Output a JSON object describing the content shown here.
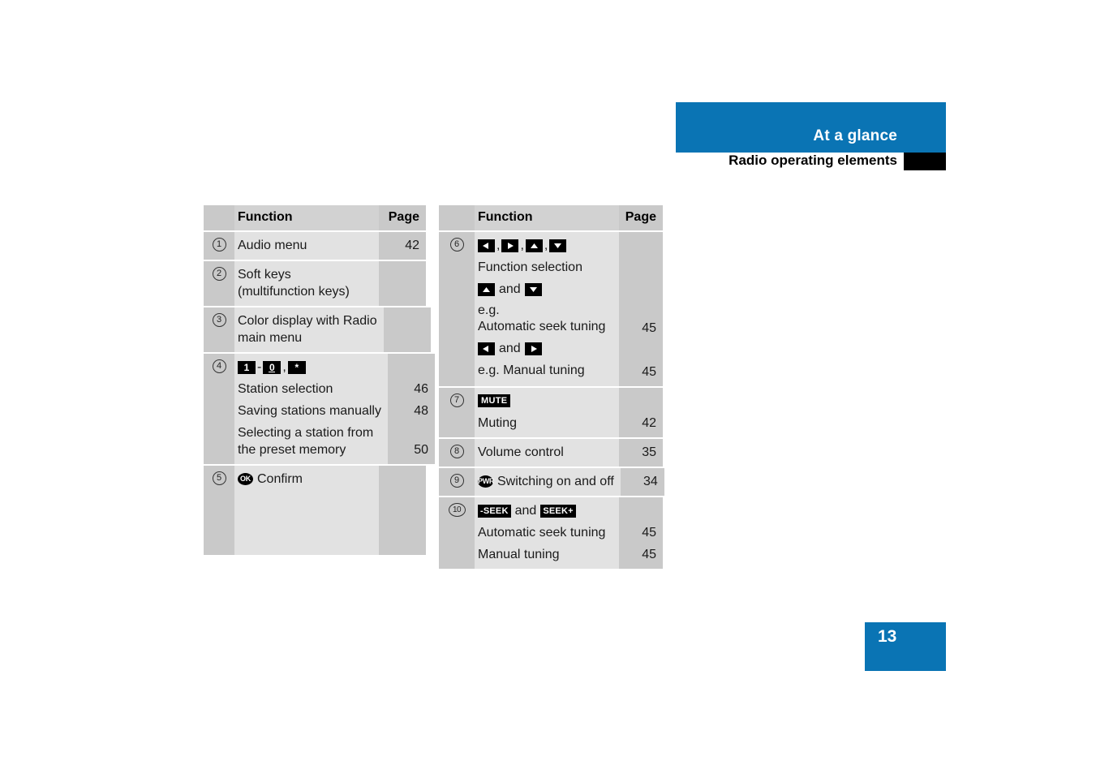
{
  "header": {
    "chapter_title": "At a glance",
    "section_title": "Radio operating elements",
    "accent_color": "#0a74b4"
  },
  "page_number": "13",
  "tables": {
    "left": {
      "columns": {
        "number": "",
        "function": "Function",
        "page": "Page"
      },
      "rows": [
        {
          "number": "1",
          "lines": [
            {
              "text": "Audio menu",
              "page": "42"
            }
          ]
        },
        {
          "number": "2",
          "lines": [
            {
              "text": "Soft keys",
              "page": ""
            },
            {
              "text": "(multifunction keys)",
              "page": ""
            }
          ]
        },
        {
          "number": "3",
          "lines": [
            {
              "text": "Color display with Radio",
              "page": ""
            },
            {
              "text": "main menu",
              "page": ""
            }
          ]
        },
        {
          "number": "4",
          "keys": [
            {
              "icon": "key-1",
              "label": "1"
            },
            {
              "icon": "dash-separator",
              "label": "-"
            },
            {
              "icon": "key-0",
              "label": "0"
            },
            {
              "icon": "comma-separator",
              "label": ","
            },
            {
              "icon": "key-star",
              "label": "*"
            }
          ],
          "lines": [
            {
              "text": "Station selection",
              "page": "46"
            },
            {
              "text": "Saving stations manually",
              "page": "48"
            },
            {
              "text": "Selecting a station from",
              "page": ""
            },
            {
              "text": "the preset memory",
              "page": "50"
            }
          ]
        },
        {
          "number": "5",
          "ok_icon": "OK",
          "lines": [
            {
              "text": "Confirm",
              "page": ""
            }
          ]
        }
      ]
    },
    "right": {
      "columns": {
        "number": "",
        "function": "Function",
        "page": "Page"
      },
      "rows": [
        {
          "number": "6",
          "keys": [
            {
              "icon": "arrow-left-key",
              "label": "◀"
            },
            {
              "icon": "comma-separator",
              "label": ","
            },
            {
              "icon": "arrow-right-key",
              "label": "▶"
            },
            {
              "icon": "comma-separator",
              "label": ","
            },
            {
              "icon": "arrow-up-key",
              "label": "▲"
            },
            {
              "icon": "comma-separator",
              "label": ","
            },
            {
              "icon": "arrow-down-key",
              "label": "▼"
            }
          ],
          "lines": [
            {
              "text": "Function selection",
              "page": ""
            }
          ],
          "keys2": {
            "first": {
              "icon": "arrow-up-key",
              "label": "▲"
            },
            "and": "and",
            "second": {
              "icon": "arrow-down-key",
              "label": "▼"
            }
          },
          "lines2": [
            {
              "text": "e.g.",
              "page": ""
            },
            {
              "text": "Automatic seek tuning",
              "page": "45"
            }
          ],
          "keys3": {
            "first": {
              "icon": "arrow-left-key",
              "label": "◀"
            },
            "and": "and",
            "second": {
              "icon": "arrow-right-key",
              "label": "▶"
            }
          },
          "lines3": [
            {
              "text": "e.g. Manual tuning",
              "page": "45"
            }
          ]
        },
        {
          "number": "7",
          "mute_key": "MUTE",
          "lines": [
            {
              "text": "Muting",
              "page": "42"
            }
          ]
        },
        {
          "number": "8",
          "lines": [
            {
              "text": "Volume control",
              "page": "35"
            }
          ]
        },
        {
          "number": "9",
          "pwr_icon": "PWR",
          "lines": [
            {
              "text": "Switching on and off",
              "page": "34"
            }
          ]
        },
        {
          "number": "10",
          "seek_keys": {
            "minus": "-SEEK",
            "and": "and",
            "plus": "SEEK+"
          },
          "lines": [
            {
              "text": "Automatic seek tuning",
              "page": "45"
            },
            {
              "text": "Manual tuning",
              "page": "45"
            }
          ]
        }
      ]
    }
  }
}
